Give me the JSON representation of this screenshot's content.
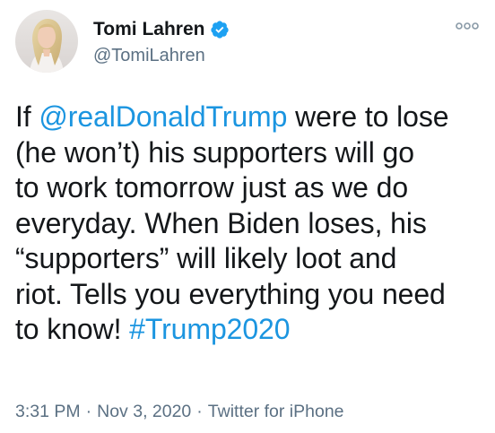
{
  "user": {
    "display_name": "Tomi Lahren",
    "handle": "@TomiLahren",
    "verified_icon": "verified-badge-icon",
    "avatar_icon": "profile-photo"
  },
  "menu": {
    "more_icon": "more-options-icon"
  },
  "tweet": {
    "lines": [
      [
        {
          "text": "If ",
          "type": "text"
        },
        {
          "text": "@realDonaldTrump",
          "type": "mention"
        },
        {
          "text": " were to lose",
          "type": "text"
        }
      ],
      [
        {
          "text": "(he won’t) his supporters will go",
          "type": "text"
        }
      ],
      [
        {
          "text": "to work tomorrow just as we do",
          "type": "text"
        }
      ],
      [
        {
          "text": "everyday. When Biden loses, his",
          "type": "text"
        }
      ],
      [
        {
          "text": "“supporters” will likely loot and",
          "type": "text"
        }
      ],
      [
        {
          "text": "riot. Tells you everything you need",
          "type": "text"
        }
      ],
      [
        {
          "text": "to know! ",
          "type": "text"
        },
        {
          "text": "#Trump2020",
          "type": "hashtag"
        }
      ]
    ]
  },
  "meta": {
    "time": "3:31 PM",
    "separator": "·",
    "date": "Nov 3, 2020",
    "source": "Twitter for iPhone"
  },
  "colors": {
    "link": "#1b95e0",
    "text": "#14171a",
    "secondary": "#5b7083",
    "verified": "#1da1f2"
  }
}
